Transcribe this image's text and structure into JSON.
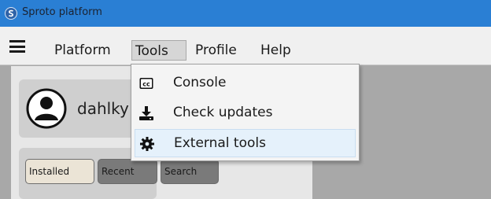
{
  "window": {
    "title": "Sproto platform",
    "icon": "sproto-logo-icon"
  },
  "menubar": {
    "menu_icon": "hamburger-icon",
    "items": [
      {
        "label": "Platform"
      },
      {
        "label": "Tools",
        "active": true
      },
      {
        "label": "Profile"
      },
      {
        "label": "Help"
      }
    ]
  },
  "dropdown": {
    "items": [
      {
        "label": "Console",
        "icon": "closed-captions-icon"
      },
      {
        "label": "Check updates",
        "icon": "download-icon"
      },
      {
        "label": "External tools",
        "icon": "gear-icon",
        "highlighted": true
      }
    ]
  },
  "user": {
    "name": "dahlky",
    "avatar": "user-avatar-icon"
  },
  "tabs": [
    {
      "label": "Installed",
      "selected": true
    },
    {
      "label": "Recent"
    },
    {
      "label": "Search"
    }
  ],
  "colors": {
    "titlebar": "#2a7fd4",
    "menubar": "#f0f0f0",
    "highlight": "#e5f1fb",
    "tab_selected": "#ebe4d6",
    "tab_unselected": "#7a7a7a"
  }
}
